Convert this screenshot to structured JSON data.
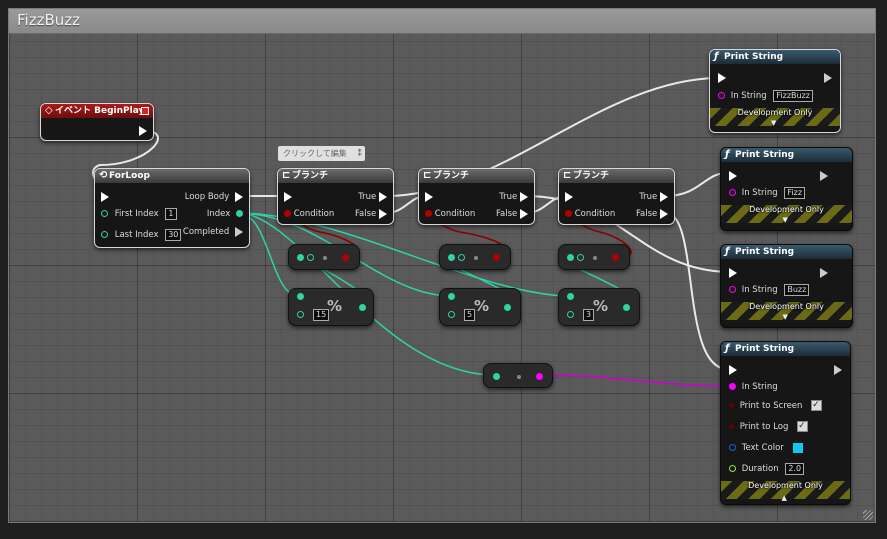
{
  "comment": {
    "title": "FizzBuzz"
  },
  "tooltip": {
    "text": "クリックして編集"
  },
  "event_node": {
    "title": "イベント BeginPlay"
  },
  "forloop": {
    "title": "ForLoop",
    "pins": {
      "loop_body": "Loop Body",
      "first_index": "First Index",
      "first_index_value": "1",
      "index": "Index",
      "last_index": "Last Index",
      "last_index_value": "30",
      "completed": "Completed"
    }
  },
  "branches": [
    {
      "title": "ブランチ",
      "true_label": "True",
      "false_label": "False",
      "condition_label": "Condition"
    },
    {
      "title": "ブランチ",
      "true_label": "True",
      "false_label": "False",
      "condition_label": "Condition"
    },
    {
      "title": "ブランチ",
      "true_label": "True",
      "false_label": "False",
      "condition_label": "Condition"
    }
  ],
  "equal_nodes": [
    {
      "symbol": "•"
    },
    {
      "symbol": "•"
    },
    {
      "symbol": "•"
    }
  ],
  "modulo_nodes": [
    {
      "symbol": "%",
      "value": "15"
    },
    {
      "symbol": "%",
      "value": "5"
    },
    {
      "symbol": "%",
      "value": "3"
    }
  ],
  "to_string_node": {
    "symbol": "•"
  },
  "print_nodes": [
    {
      "title": "Print String",
      "in_string_label": "In String",
      "in_string_value": "FizzBuzz",
      "dev_label": "Development Only"
    },
    {
      "title": "Print String",
      "in_string_label": "In String",
      "in_string_value": "Fizz",
      "dev_label": "Development Only"
    },
    {
      "title": "Print String",
      "in_string_label": "In String",
      "in_string_value": "Buzz",
      "dev_label": "Development Only"
    },
    {
      "title": "Print String",
      "in_string_label": "In String",
      "dev_label": "Development Only",
      "print_to_screen": "Print to Screen",
      "print_to_log": "Print to Log",
      "text_color": "Text Color",
      "text_color_value": "#13c6f2",
      "duration": "Duration",
      "duration_value": "2.0"
    }
  ],
  "icons": {
    "function": "function-icon",
    "event": "event-diamond-icon",
    "loop": "loop-icon",
    "branch": "branch-icon"
  },
  "colors": {
    "exec": "#ffffff",
    "integer": "#2ed3a6",
    "boolean": "#b30000",
    "string": "#ff00ff",
    "linear_color": "#2060d0",
    "float": "#a0e040",
    "event_header": "#b01818",
    "function_header": "#3a5a6e"
  }
}
